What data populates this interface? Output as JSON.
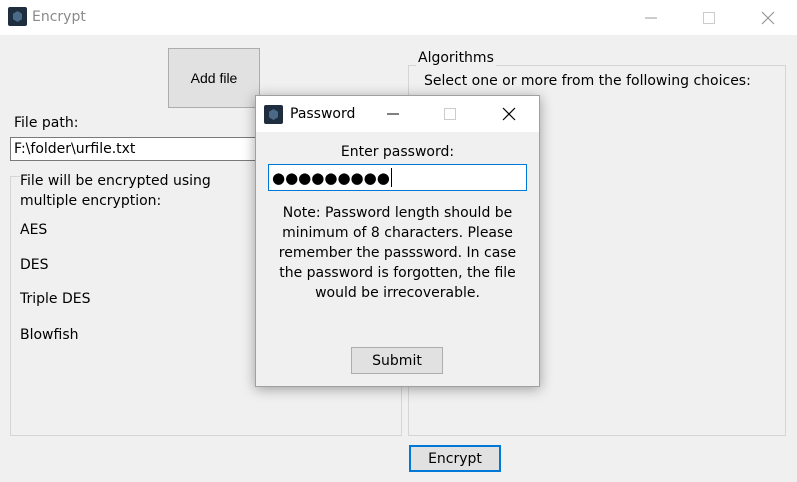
{
  "window": {
    "title": "Encrypt"
  },
  "left_panel": {
    "add_file_label": "Add file",
    "file_path_label": "File path:",
    "file_path_value": "F:\\folder\\urfile.txt",
    "info_text": "File will be encrypted using multiple encryption:",
    "algorithms": [
      "AES",
      "DES",
      "Triple DES",
      "Blowfish"
    ]
  },
  "right_panel": {
    "legend": "Algorithms",
    "instruction": "Select one or more from the following choices:"
  },
  "encrypt_label": "Encrypt",
  "dialog": {
    "title": "Password",
    "prompt": "Enter password:",
    "password_masked": "●●●●●●●●●",
    "note": "Note: Password length should be minimum of 8 characters. Please remember the passsword. In case the password is forgotten, the file would be irrecoverable.",
    "submit_label": "Submit"
  },
  "icons": {
    "app": "shield-app-icon",
    "minimize": "minimize-icon",
    "maximize": "maximize-icon",
    "close": "close-icon"
  },
  "colors": {
    "accent": "#0078d7",
    "window_bg": "#f0f0f0",
    "titlebar_bg": "#ffffff",
    "button_bg": "#e1e1e1"
  }
}
